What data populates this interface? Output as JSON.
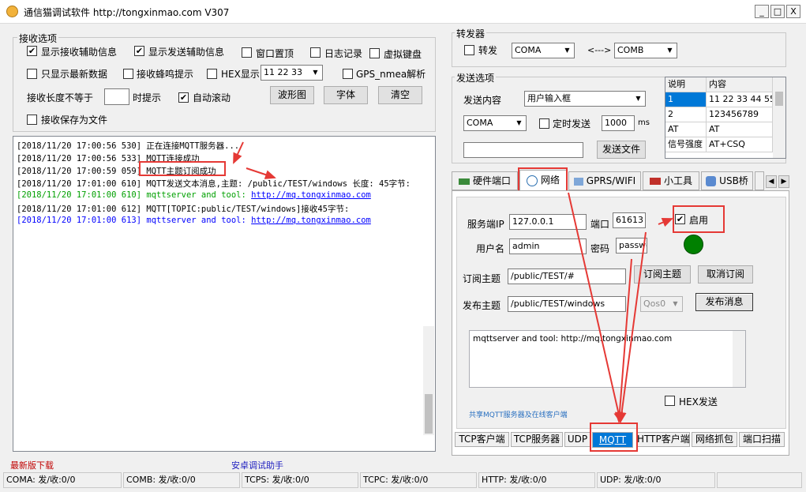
{
  "window": {
    "title": "通信猫调试软件   http://tongxinmao.com   V307",
    "controls": [
      "_",
      "□",
      "X"
    ]
  },
  "receive_options": {
    "legend": "接收选项",
    "show_recv_info": "显示接收辅助信息",
    "show_send_info": "显示发送辅助信息",
    "window_top": "窗口置顶",
    "log_record": "日志记录",
    "virtual_keyboard": "虚拟键盘",
    "only_latest": "只显示最新数据",
    "recv_beep": "接收蜂鸣提示",
    "hex_display": "HEX显示",
    "hex_value": "11 22 33",
    "gps_parse": "GPS_nmea解析",
    "recv_len_label": "接收长度不等于",
    "recv_len_value": "",
    "prompt": "时提示",
    "auto_scroll": "自动滚动",
    "waveform_btn": "波形图",
    "font_btn": "字体",
    "clear_btn": "清空",
    "save_file": "接收保存为文件"
  },
  "log": {
    "lines": [
      {
        "ts": "[2018/11/20 17:00:56 530]",
        "text": "正在连接MQTT服务器..."
      },
      {
        "ts": "[2018/11/20 17:00:56 533]",
        "text": "MQTT连接成功"
      },
      {
        "ts": "[2018/11/20 17:00:59 059]",
        "text": "MQTT主题订阅成功"
      },
      {
        "ts": "[2018/11/20 17:01:00 610]",
        "text": "MQTT发送文本消息,主题: /public/TEST/windows 长度: 45字节:"
      },
      {
        "ts": "[2018/11/20 17:01:00 610]",
        "text": "mqttserver and tool: ",
        "link": "http://mq.tongxinmao.com"
      },
      {
        "ts": "[2018/11/20 17:01:00 612]",
        "text": "MQTT[TOPIC:public/TEST/windows]接收45字节:"
      },
      {
        "ts": "[2018/11/20 17:01:00 613]",
        "text": "mqttserver and tool: ",
        "link": "http://mq.tongxinmao.com"
      }
    ],
    "colors": {
      "normal": "#000000",
      "send": "#00a000",
      "recv": "#0000ff",
      "link": "#0000ff"
    }
  },
  "bottom_links": {
    "download": "最新版下载",
    "android": "安卓调试助手"
  },
  "forwarder": {
    "legend": "转发器",
    "forward": "转发",
    "port_a": "COMA",
    "arrow": "<--->",
    "port_b": "COMB"
  },
  "send_options": {
    "legend": "发送选项",
    "content_label": "发送内容",
    "content_mode": "用户输入框",
    "port": "COMA",
    "timed_send": "定时发送",
    "interval": "1000",
    "unit": "ms",
    "send_file_btn": "发送文件",
    "table": {
      "headers": [
        "说明",
        "内容"
      ],
      "rows": [
        [
          "1",
          "11 22 33 44 55"
        ],
        [
          "2",
          "123456789"
        ],
        [
          "AT",
          "AT"
        ],
        [
          "信号强度",
          "AT+CSQ"
        ]
      ]
    }
  },
  "main_tabs": [
    "硬件端口",
    "网络",
    "GPRS/WIFI",
    "小工具",
    "USB桥"
  ],
  "mqtt": {
    "server_ip_label": "服务端IP",
    "server_ip": "127.0.0.1",
    "port_label": "端口",
    "port": "61613",
    "enable": "启用",
    "user_label": "用户名",
    "user": "admin",
    "pass_label": "密码",
    "pass": "passwo",
    "sub_label": "订阅主题",
    "sub_topic": "/public/TEST/#",
    "sub_btn": "订阅主题",
    "unsub_btn": "取消订阅",
    "pub_label": "发布主题",
    "pub_topic": "/public/TEST/windows",
    "qos": "Qos0",
    "pub_btn": "发布消息",
    "message": "mqttserver and tool: http://mq.tongxinmao.com",
    "hex_send": "HEX发送",
    "share_text": "共享MQTT服务器及在线客户端",
    "status_color": "#008000"
  },
  "sub_tabs": [
    "TCP客户端",
    "TCP服务器",
    "UDP",
    "MQTT",
    "HTTP客户端",
    "网络抓包",
    "端口扫描"
  ],
  "status_bar": [
    "COMA: 发/收:0/0",
    "COMB: 发/收:0/0",
    "TCPS: 发/收:0/0",
    "TCPC: 发/收:0/0",
    "HTTP: 发/收:0/0",
    "UDP: 发/收:0/0"
  ]
}
